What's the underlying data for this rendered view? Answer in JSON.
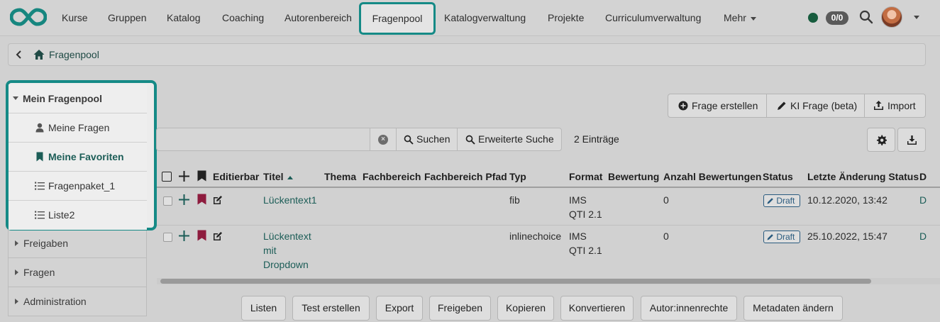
{
  "nav": {
    "items": [
      "Kurse",
      "Gruppen",
      "Katalog",
      "Coaching",
      "Autorenbereich",
      "Fragenpool",
      "Katalogverwaltung",
      "Projekte",
      "Curriculumverwaltung",
      "Mehr"
    ],
    "active": "Fragenpool",
    "counter": "0/0",
    "status_color": "#175c3e",
    "accent_color": "#158a86"
  },
  "breadcrumb": {
    "label": "Fragenpool"
  },
  "sidebar": {
    "section_title": "Mein Fragenpool",
    "items": [
      {
        "label": "Meine Fragen",
        "icon": "user-icon"
      },
      {
        "label": "Meine Favoriten",
        "icon": "bookmark-icon",
        "active": true
      },
      {
        "label": "Fragenpaket_1",
        "icon": "list-icon"
      },
      {
        "label": "Liste2",
        "icon": "list-icon"
      }
    ],
    "other_sections": [
      "Freigaben",
      "Fragen",
      "Administration"
    ]
  },
  "actions": {
    "create": "Frage erstellen",
    "ai": "KI Frage (beta)",
    "import": "Import"
  },
  "search": {
    "search_label": "Suchen",
    "advanced_label": "Erweiterte Suche",
    "entries": "2 Einträge"
  },
  "table": {
    "headers": [
      "Editierbar",
      "Titel",
      "Thema",
      "Fachbereich",
      "Fachbereich Pfad",
      "Typ",
      "Format",
      "Bewertung",
      "Anzahl Bewertungen",
      "Status",
      "Letzte Änderung Status",
      "D"
    ],
    "rows": [
      {
        "title": "Lückentext1",
        "type": "fib",
        "format_line1": "IMS",
        "format_line2": "QTI 2.1",
        "ratings_count": "0",
        "status": "Draft",
        "last_change": "10.12.2020, 13:42",
        "extra": "D"
      },
      {
        "title_line1": "Lückentext",
        "title_line2": "mit",
        "title_line3": "Dropdown",
        "type": "inlinechoice",
        "format_line1": "IMS",
        "format_line2": "QTI 2.1",
        "ratings_count": "0",
        "status": "Draft",
        "last_change": "25.10.2022, 15:47",
        "extra": "D"
      }
    ]
  },
  "bottom_buttons": [
    "Listen",
    "Test erstellen",
    "Export",
    "Freigeben",
    "Kopieren",
    "Konvertieren",
    "Autor:innenrechte",
    "Metadaten ändern"
  ]
}
